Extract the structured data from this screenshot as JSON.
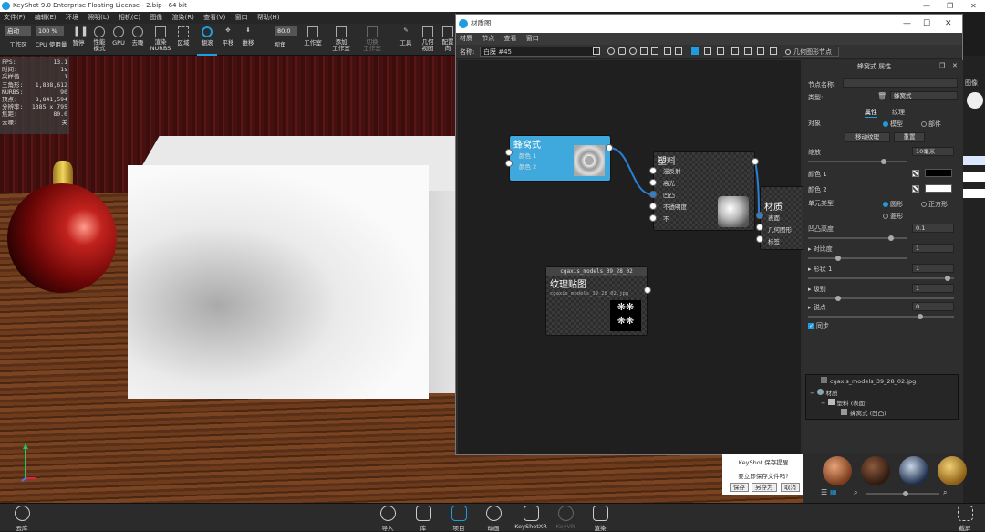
{
  "window": {
    "title": "KeyShot 9.0 Enterprise Floating License  - 2.bip  - 64 bit"
  },
  "menubar": [
    "文件(F)",
    "编辑(E)",
    "环境",
    "照明(L)",
    "相机(C)",
    "图像",
    "渲染(R)",
    "查看(V)",
    "窗口",
    "帮助(H)"
  ],
  "toolbar": {
    "mode_value": "启动",
    "zoom_value": "100 %",
    "camera_value": "80.0",
    "buttons": [
      {
        "label": "工作区"
      },
      {
        "label": "CPU 使用量"
      },
      {
        "label": "暂停"
      },
      {
        "label": "性能\n模式"
      },
      {
        "label": "GPU"
      },
      {
        "label": "去噪"
      },
      {
        "label": "渲染\nNURBS"
      },
      {
        "label": "区域"
      },
      {
        "label": "翻滚"
      },
      {
        "label": "平移"
      },
      {
        "label": "推移"
      },
      {
        "label": "视角"
      },
      {
        "label": "工作室"
      },
      {
        "label": "添加\n工作室"
      },
      {
        "label": "切换\n工作室"
      },
      {
        "label": "工具"
      },
      {
        "label": "几何\n视图"
      },
      {
        "label": "配置\n向"
      }
    ]
  },
  "hud": [
    {
      "k": "FPS:",
      "v": "13.1"
    },
    {
      "k": "时间:",
      "v": "1s"
    },
    {
      "k": "采样值",
      "v": "1"
    },
    {
      "k": "三角形:",
      "v": "1,838,612"
    },
    {
      "k": "NURBS:",
      "v": "90"
    },
    {
      "k": "顶点:",
      "v": "8,841,594"
    },
    {
      "k": "分辨率:",
      "v": "1385 x 795"
    },
    {
      "k": "焦距:",
      "v": "80.0"
    },
    {
      "k": "去噪:",
      "v": "关"
    }
  ],
  "material_graph": {
    "title": "材质图",
    "menu": [
      "材质",
      "节点",
      "查看",
      "窗口"
    ],
    "name_label": "名称:",
    "name_value": "白膜 #45",
    "geometry_node_button": "几何图形节点",
    "nodes": {
      "honeycomb": {
        "title": "蜂窝式",
        "inputs": [
          "颜色 1",
          "颜色 2"
        ]
      },
      "plastic": {
        "title": "塑料",
        "inputs": [
          "漫反射",
          "高光",
          "凹凸",
          "不透明度",
          "不"
        ]
      },
      "material": {
        "title": "材质",
        "inputs": [
          "表面",
          "几何图形",
          "标签"
        ]
      },
      "texture": {
        "header": "cgaxis_models_39_28_02",
        "title": "纹理贴图",
        "sub": "cgaxis_models_39_28_02.jpg"
      }
    }
  },
  "properties": {
    "header": "蜂窝式 属性",
    "node_name_label": "节点名称:",
    "type_label": "类型:",
    "type_value": "蜂窝式",
    "tabs": [
      "属性",
      "纹理"
    ],
    "object_label": "对象",
    "object_options": [
      "模型",
      "部件"
    ],
    "move_texture": "移动纹理",
    "reset": "重置",
    "scale_label": "缩放",
    "scale_value": "10毫米",
    "color1_label": "颜色 1",
    "color2_label": "颜色 2",
    "cell_type_label": "单元类型",
    "cell_type_options": [
      "圆形",
      "正方形",
      "菱形"
    ],
    "bump_label": "凹凸高度",
    "bump_value": "0.1",
    "contrast_label": "对比度",
    "contrast_value": "1",
    "shape1_label": "形状 1",
    "shape1_value": "1",
    "level_label": "级别",
    "level_value": "1",
    "sharp_label": "锐点",
    "sharp_value": "0",
    "sync_label": "同步",
    "colors": {
      "color1": "#000000",
      "color2": "#ffffff"
    }
  },
  "tree": [
    {
      "label": "cgaxis_models_39_28_02.jpg"
    },
    {
      "label": "材质"
    },
    {
      "label": "塑料 (表面)"
    },
    {
      "label": "蜂窝式 (凹凸)"
    }
  ],
  "save_dialog": {
    "title": "KeyShot 保存提醒",
    "message": "要立即保存文件吗?",
    "buttons": [
      "保存",
      "另存为",
      "取消"
    ]
  },
  "bottombar": [
    {
      "label": "云库"
    },
    {
      "label": "导入"
    },
    {
      "label": "库"
    },
    {
      "label": "项目"
    },
    {
      "label": "动画"
    },
    {
      "label": "KeyShotXR"
    },
    {
      "label": "KeyVR"
    },
    {
      "label": "渲染"
    },
    {
      "label": "截屏"
    }
  ],
  "side_labels": {
    "image": "图像"
  },
  "accent": "#1f9be0"
}
